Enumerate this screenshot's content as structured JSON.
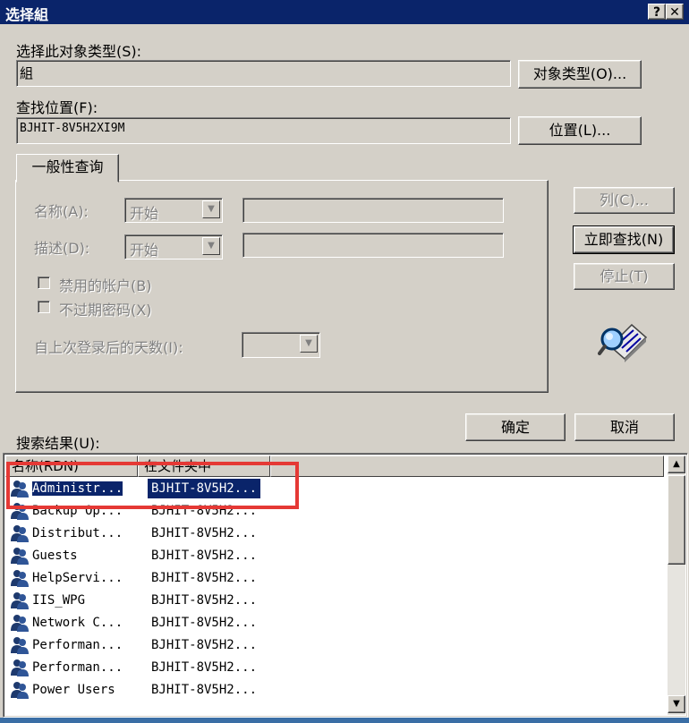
{
  "window": {
    "title": "选择組",
    "help_label": "?",
    "close_label": "✕"
  },
  "object_type": {
    "label": "选择此对象类型(S):",
    "value": "組",
    "button": "对象类型(O)..."
  },
  "location": {
    "label": "查找位置(F):",
    "value": "BJHIT-8V5H2XI9M",
    "button": "位置(L)..."
  },
  "query_tab": {
    "label": "一般性查询",
    "name_label": "名称(A):",
    "name_combo": "开始",
    "desc_label": "描述(D):",
    "desc_combo": "开始",
    "disabled_accounts": "禁用的帐户(B)",
    "nonexpiring_pw": "不过期密码(X)",
    "days_since_logon": "自上次登录后的天数(I):"
  },
  "side_buttons": {
    "columns": "列(C)...",
    "find_now": "立即查找(N)",
    "stop": "停止(T)"
  },
  "dialog_buttons": {
    "ok": "确定",
    "cancel": "取消"
  },
  "results": {
    "label": "搜索结果(U):",
    "columns": [
      "名称(RDN)",
      "在文件夹中"
    ],
    "rows": [
      {
        "name": "Administr...",
        "folder": "BJHIT-8V5H2..."
      },
      {
        "name": "Backup Op...",
        "folder": "BJHIT-8V5H2..."
      },
      {
        "name": "Distribut...",
        "folder": "BJHIT-8V5H2..."
      },
      {
        "name": "Guests",
        "folder": "BJHIT-8V5H2..."
      },
      {
        "name": "HelpServi...",
        "folder": "BJHIT-8V5H2..."
      },
      {
        "name": "IIS_WPG",
        "folder": "BJHIT-8V5H2..."
      },
      {
        "name": "Network C...",
        "folder": "BJHIT-8V5H2..."
      },
      {
        "name": "Performan...",
        "folder": "BJHIT-8V5H2..."
      },
      {
        "name": "Performan...",
        "folder": "BJHIT-8V5H2..."
      },
      {
        "name": "Power Users",
        "folder": "BJHIT-8V5H2..."
      }
    ]
  },
  "colors": {
    "titlebar": "#0a246a",
    "face": "#d4d0c8",
    "highlight_box": "#e53935"
  }
}
